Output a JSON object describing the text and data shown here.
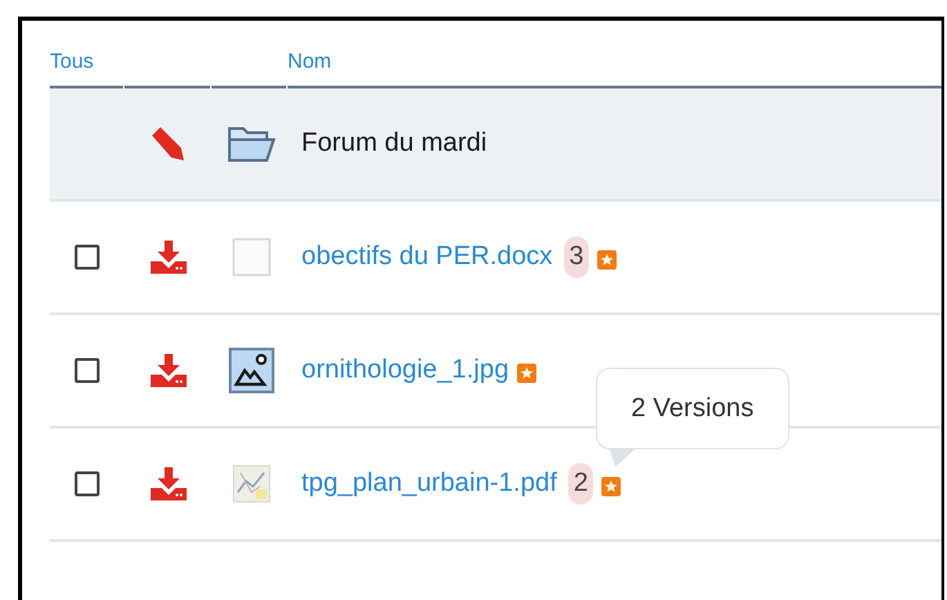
{
  "table": {
    "columns": {
      "select_all": "Tous",
      "name": "Nom"
    },
    "rows": [
      {
        "kind": "folder",
        "name": "Forum du mardi"
      },
      {
        "kind": "document",
        "checked": false,
        "name": "obectifs du PER.docx",
        "versions": "3"
      },
      {
        "kind": "image",
        "checked": false,
        "name": "ornithologie_1.jpg"
      },
      {
        "kind": "map",
        "checked": false,
        "name": "tpg_plan_urbain-1.pdf",
        "versions": "2",
        "tooltip": "2 Versions"
      }
    ]
  }
}
